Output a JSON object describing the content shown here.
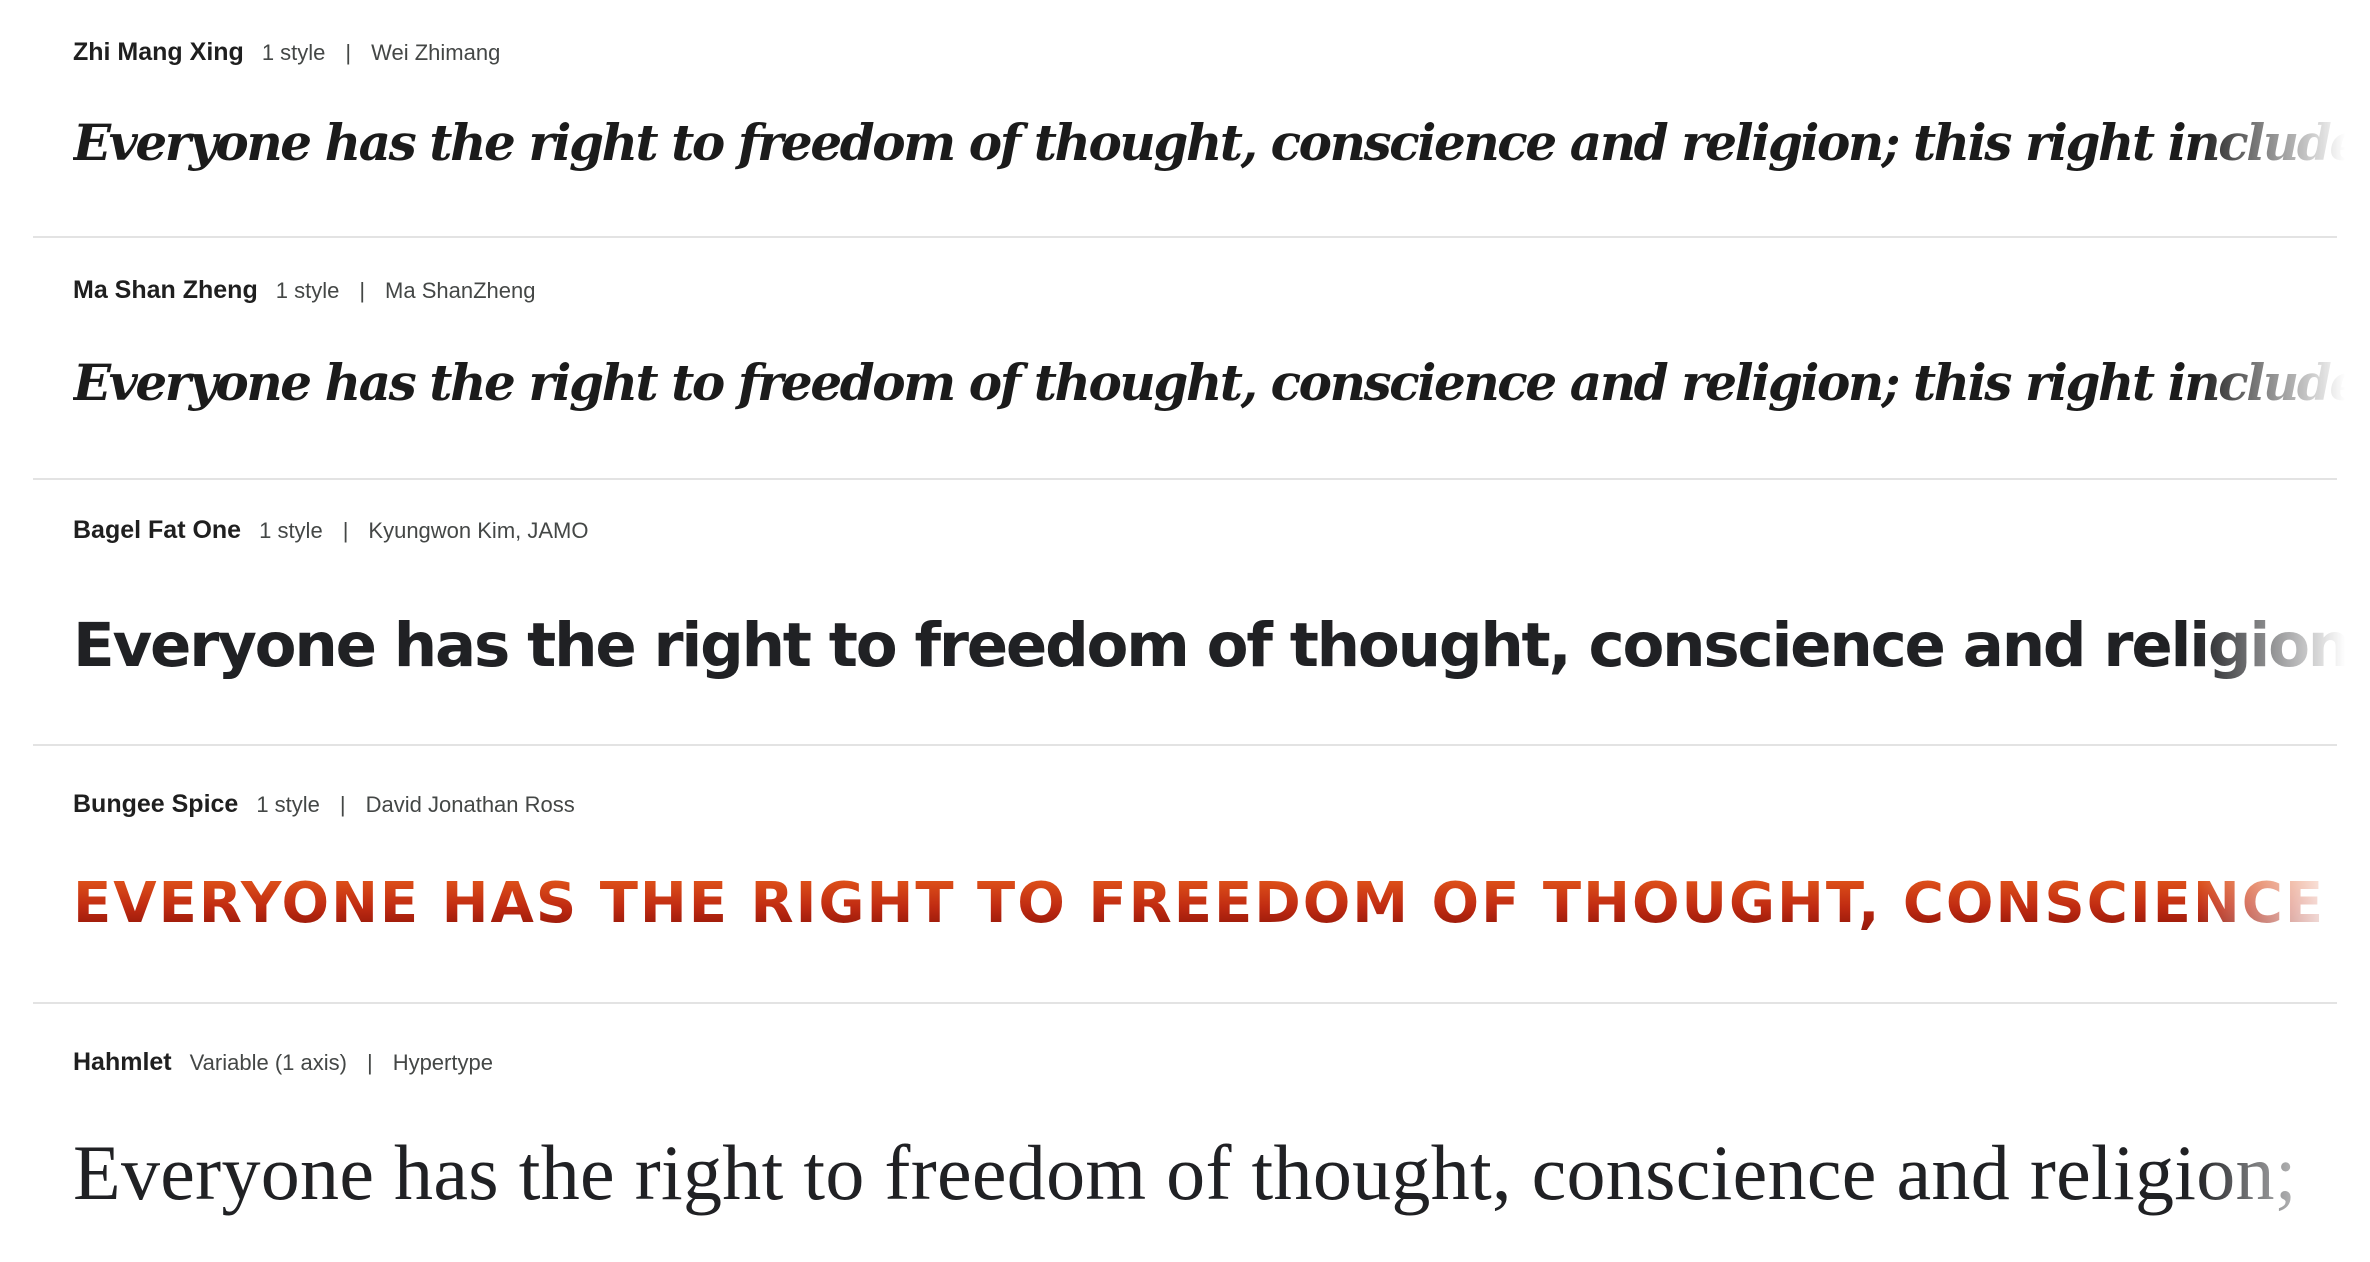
{
  "fonts": [
    {
      "name": "Zhi Mang Xing",
      "styles": "1 style",
      "separator": "|",
      "designer": "Wei Zhimang",
      "preview": "Everyone has the right to freedom of thought, conscience and religion; this right includes freedom to change his rel"
    },
    {
      "name": "Ma Shan Zheng",
      "styles": "1 style",
      "separator": "|",
      "designer": "Ma ShanZheng",
      "preview": "Everyone has the right to freedom of thought, conscience and religion; this right includes freedom to change his rel"
    },
    {
      "name": "Bagel Fat One",
      "styles": "1 style",
      "separator": "|",
      "designer": "Kyungwon Kim, JAMO",
      "preview": "Everyone has the right to freedom of thought, conscience and religion; this ri"
    },
    {
      "name": "Bungee Spice",
      "styles": "1 style",
      "separator": "|",
      "designer": "David Jonathan Ross",
      "preview": "EVERYONE HAS THE RIGHT TO FREEDOM OF THOUGHT, CONSCIENCE"
    },
    {
      "name": "Hahmlet",
      "styles": "Variable (1 axis)",
      "separator": "|",
      "designer": "Hypertype",
      "preview": "Everyone has the right to freedom of thought, conscience and religion;"
    }
  ],
  "colors": {
    "divider": "#e3e3e3",
    "text_primary": "#1f1f1f",
    "text_secondary": "#444746",
    "bungee_gradient_top": "#e2561a",
    "bungee_gradient_bottom": "#8f1508"
  }
}
